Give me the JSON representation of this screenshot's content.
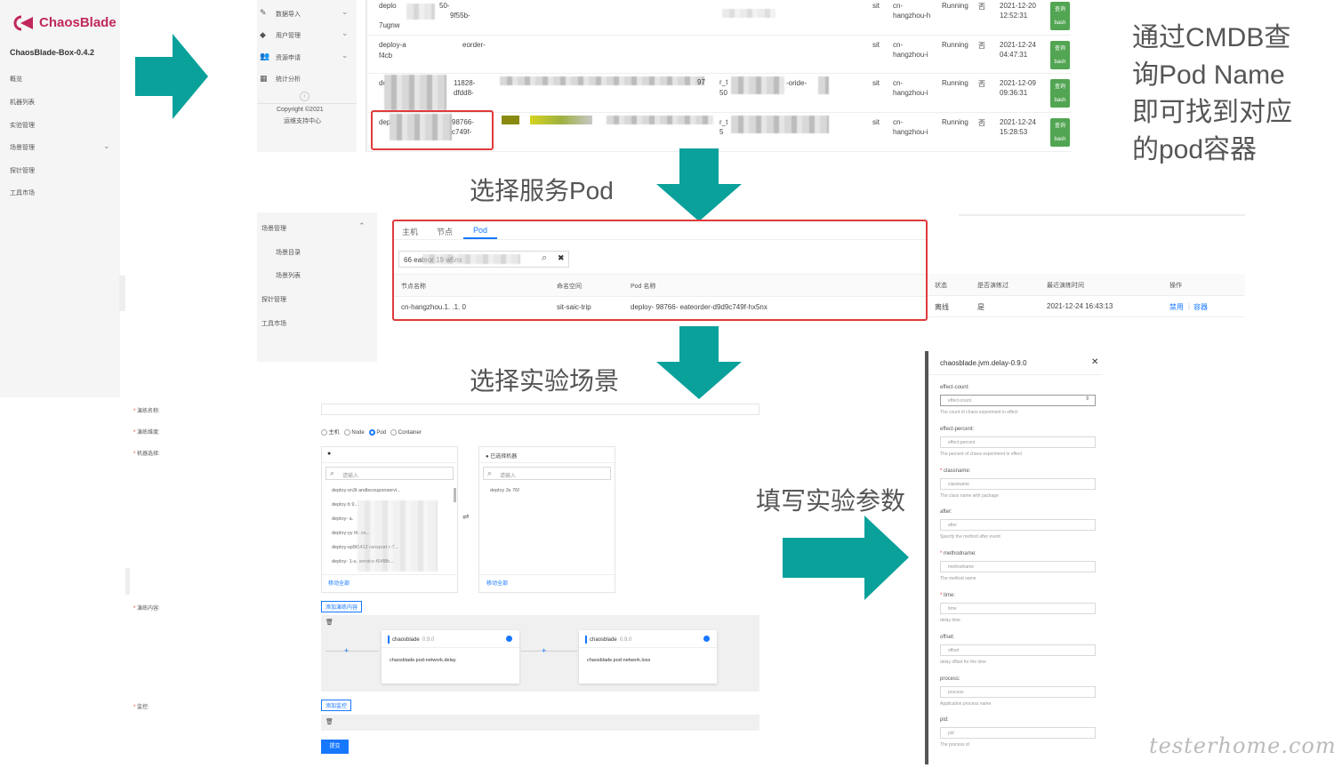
{
  "brand": {
    "name": "ChaosBlade",
    "version": "ChaosBlade-Box-0.4.2",
    "color": "#c0275d"
  },
  "left_nav": [
    "概览",
    "机器列表",
    "实验管理",
    "场景管理",
    "探针管理",
    "工具市场"
  ],
  "top_menu": [
    "数据导入",
    "用户管理",
    "资源申请",
    "统计分析"
  ],
  "copyright": [
    "Copyright ©2021",
    "运维支持中心"
  ],
  "pod_table": {
    "rows": [
      {
        "name1": "deplo",
        "name2": "7ugnw",
        "c2": "50-",
        "c2b": "9f55b-",
        "env": "sit",
        "region1": "cn-",
        "region2": "hangzhou-h",
        "status": "Running",
        "flag": "否",
        "date1": "2021-12-20",
        "date2": "12:52:31"
      },
      {
        "name1": "deploy-a",
        "name2": "f4cb",
        "c2": "eorder-",
        "c2b": "",
        "env": "sit",
        "region1": "cn-",
        "region2": "hangzhou-i",
        "status": "Running",
        "flag": "否",
        "date1": "2021-12-24",
        "date2": "04:47:31"
      },
      {
        "name1": "depl",
        "name2": "",
        "c2": "11828-",
        "c2b": "dfdd8-",
        "env": "sit",
        "region1": "cn-",
        "region2": "hangzhou-i",
        "status": "Running",
        "flag": "否",
        "date1": "2021-12-09",
        "date2": "09:36:31"
      },
      {
        "name1": "depl",
        "name2": "",
        "c2": "98766-",
        "c2b": "c749f-",
        "env": "sit",
        "region1": "cn-",
        "region2": "hangzhou-i",
        "status": "Running",
        "flag": "否",
        "date1": "2021-12-24",
        "date2": "15:28:53"
      }
    ],
    "misc": [
      "97",
      "r_t",
      "50",
      "r_",
      "56.",
      "r_t",
      "5",
      "-oride-",
      "-oride-"
    ],
    "action_top": "查询",
    "action_bottom": "bash"
  },
  "hints": {
    "cmdb": [
      "通过CMDB查",
      "询Pod Name",
      "即可找到对应",
      "的pod容器"
    ],
    "select_pod": "选择服务Pod",
    "select_scene": "选择实验场景",
    "fill_params": "填写实验参数"
  },
  "scene_nav": {
    "group": "场景管理",
    "items": [
      "场景目录",
      "场景列表"
    ],
    "others": [
      "探针管理",
      "工具市场"
    ]
  },
  "pod_select": {
    "tabs": [
      "主机",
      "节点",
      "Pod"
    ],
    "search_value": "66 eateor 19 w5nx",
    "headers": [
      "节点名称",
      "命名空间",
      "Pod 名称",
      "状态",
      "是否演练过",
      "最近演练时间",
      "操作"
    ],
    "row": {
      "node": "cn-hangzhou.1.     .1.     0",
      "namespace": "sit-saic-trip",
      "pod": "deploy-          98766-      eateorder-d9d9c749f-hx5nx",
      "status": "离线",
      "drilled": "是",
      "time": "2021-12-24 16:43:13",
      "op1": "禁用",
      "op2": "容器"
    }
  },
  "form": {
    "labels": [
      "演练名称:",
      "演练维度:",
      "机器选择:",
      "演练内容:",
      "监控:"
    ],
    "radios": [
      "主机",
      "Node",
      "Pod",
      "Container"
    ],
    "left_list_placeholder": "请输入",
    "left_items": [
      "deploy-sn3t        andlecouponservi...",
      "deploy           b          9...",
      "deploy-          a.",
      "deploy-yy        th.           ze...",
      "deploy-sp5f1412         ransport       r-7...",
      "deploy-          1-u.          service-f64f8b..."
    ],
    "move_all": "移动全部",
    "right_title": "已选择机器",
    "right_item": "deploy           3s         76f",
    "add_content": "添加演练内容",
    "cards": [
      {
        "title": "chaosblade",
        "ver": "0.9.0",
        "name": "chaosblade.pod-network.delay"
      },
      {
        "title": "chaosblade",
        "ver": "0.9.0",
        "name": "chaosblade.pod-network.loss"
      }
    ],
    "add_monitor": "添加监控",
    "submit": "提交"
  },
  "param_panel": {
    "title": "chaosblade.jvm.delay-0.9.0",
    "fields": [
      {
        "label": "effect-count:",
        "placeholder": "effect-count",
        "help": "The count of chaos experiment in effect",
        "req": false
      },
      {
        "label": "effect-percent:",
        "placeholder": "effect-percent",
        "help": "The percent of chaos experiment in effect",
        "req": false
      },
      {
        "label": "classname:",
        "placeholder": "classname",
        "help": "The class name with package",
        "req": true
      },
      {
        "label": "after:",
        "placeholder": "after",
        "help": "Specify the method after event",
        "req": false
      },
      {
        "label": "methodname:",
        "placeholder": "methodname",
        "help": "The method name",
        "req": true
      },
      {
        "label": "time:",
        "placeholder": "time",
        "help": "delay time",
        "req": true
      },
      {
        "label": "offset:",
        "placeholder": "offset",
        "help": "delay offset for the time",
        "req": false
      },
      {
        "label": "process:",
        "placeholder": "process",
        "help": "Application process name",
        "req": false
      },
      {
        "label": "pid:",
        "placeholder": "pid",
        "help": "The process id",
        "req": false
      }
    ]
  },
  "watermark": "testerhome.com",
  "colors": {
    "teal": "#0aa19a",
    "red": "#e03a3a",
    "blue": "#1677ff",
    "green": "#52a552"
  }
}
